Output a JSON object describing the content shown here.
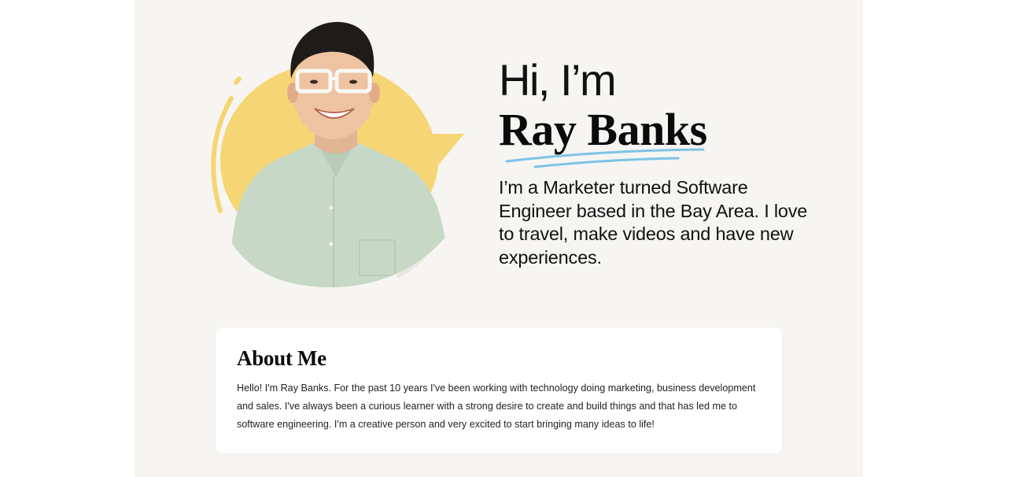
{
  "hero": {
    "greeting": "Hi, I’m",
    "name": "Ray Banks",
    "tagline": "I’m a Marketer turned Software Engineer based in the Bay Area. I love to travel, make videos and have new experiences.",
    "portrait_icon": "person-portrait",
    "accent_yellow": "#f6d674",
    "accent_blue": "#7cc4e6"
  },
  "about": {
    "title": "About Me",
    "body": "Hello! I'm Ray Banks. For the past 10 years I've been working with technology doing marketing, business development and sales. I've always been a curious learner with a strong desire to create and build things and that has led me to software engineering. I'm a creative person and very excited to start bringing many ideas to life!"
  }
}
